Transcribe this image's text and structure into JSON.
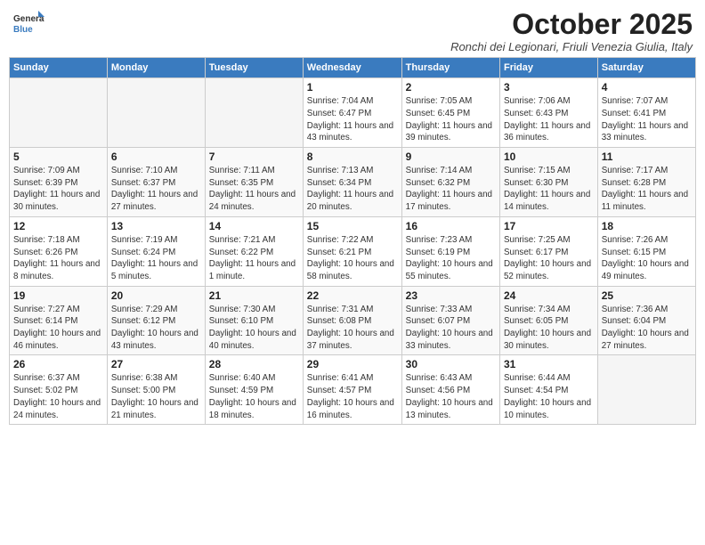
{
  "header": {
    "logo_line1": "General",
    "logo_line2": "Blue",
    "month_year": "October 2025",
    "location": "Ronchi dei Legionari, Friuli Venezia Giulia, Italy"
  },
  "days_of_week": [
    "Sunday",
    "Monday",
    "Tuesday",
    "Wednesday",
    "Thursday",
    "Friday",
    "Saturday"
  ],
  "weeks": [
    [
      {
        "day": "",
        "info": ""
      },
      {
        "day": "",
        "info": ""
      },
      {
        "day": "",
        "info": ""
      },
      {
        "day": "1",
        "info": "Sunrise: 7:04 AM\nSunset: 6:47 PM\nDaylight: 11 hours and 43 minutes."
      },
      {
        "day": "2",
        "info": "Sunrise: 7:05 AM\nSunset: 6:45 PM\nDaylight: 11 hours and 39 minutes."
      },
      {
        "day": "3",
        "info": "Sunrise: 7:06 AM\nSunset: 6:43 PM\nDaylight: 11 hours and 36 minutes."
      },
      {
        "day": "4",
        "info": "Sunrise: 7:07 AM\nSunset: 6:41 PM\nDaylight: 11 hours and 33 minutes."
      }
    ],
    [
      {
        "day": "5",
        "info": "Sunrise: 7:09 AM\nSunset: 6:39 PM\nDaylight: 11 hours and 30 minutes."
      },
      {
        "day": "6",
        "info": "Sunrise: 7:10 AM\nSunset: 6:37 PM\nDaylight: 11 hours and 27 minutes."
      },
      {
        "day": "7",
        "info": "Sunrise: 7:11 AM\nSunset: 6:35 PM\nDaylight: 11 hours and 24 minutes."
      },
      {
        "day": "8",
        "info": "Sunrise: 7:13 AM\nSunset: 6:34 PM\nDaylight: 11 hours and 20 minutes."
      },
      {
        "day": "9",
        "info": "Sunrise: 7:14 AM\nSunset: 6:32 PM\nDaylight: 11 hours and 17 minutes."
      },
      {
        "day": "10",
        "info": "Sunrise: 7:15 AM\nSunset: 6:30 PM\nDaylight: 11 hours and 14 minutes."
      },
      {
        "day": "11",
        "info": "Sunrise: 7:17 AM\nSunset: 6:28 PM\nDaylight: 11 hours and 11 minutes."
      }
    ],
    [
      {
        "day": "12",
        "info": "Sunrise: 7:18 AM\nSunset: 6:26 PM\nDaylight: 11 hours and 8 minutes."
      },
      {
        "day": "13",
        "info": "Sunrise: 7:19 AM\nSunset: 6:24 PM\nDaylight: 11 hours and 5 minutes."
      },
      {
        "day": "14",
        "info": "Sunrise: 7:21 AM\nSunset: 6:22 PM\nDaylight: 11 hours and 1 minute."
      },
      {
        "day": "15",
        "info": "Sunrise: 7:22 AM\nSunset: 6:21 PM\nDaylight: 10 hours and 58 minutes."
      },
      {
        "day": "16",
        "info": "Sunrise: 7:23 AM\nSunset: 6:19 PM\nDaylight: 10 hours and 55 minutes."
      },
      {
        "day": "17",
        "info": "Sunrise: 7:25 AM\nSunset: 6:17 PM\nDaylight: 10 hours and 52 minutes."
      },
      {
        "day": "18",
        "info": "Sunrise: 7:26 AM\nSunset: 6:15 PM\nDaylight: 10 hours and 49 minutes."
      }
    ],
    [
      {
        "day": "19",
        "info": "Sunrise: 7:27 AM\nSunset: 6:14 PM\nDaylight: 10 hours and 46 minutes."
      },
      {
        "day": "20",
        "info": "Sunrise: 7:29 AM\nSunset: 6:12 PM\nDaylight: 10 hours and 43 minutes."
      },
      {
        "day": "21",
        "info": "Sunrise: 7:30 AM\nSunset: 6:10 PM\nDaylight: 10 hours and 40 minutes."
      },
      {
        "day": "22",
        "info": "Sunrise: 7:31 AM\nSunset: 6:08 PM\nDaylight: 10 hours and 37 minutes."
      },
      {
        "day": "23",
        "info": "Sunrise: 7:33 AM\nSunset: 6:07 PM\nDaylight: 10 hours and 33 minutes."
      },
      {
        "day": "24",
        "info": "Sunrise: 7:34 AM\nSunset: 6:05 PM\nDaylight: 10 hours and 30 minutes."
      },
      {
        "day": "25",
        "info": "Sunrise: 7:36 AM\nSunset: 6:04 PM\nDaylight: 10 hours and 27 minutes."
      }
    ],
    [
      {
        "day": "26",
        "info": "Sunrise: 6:37 AM\nSunset: 5:02 PM\nDaylight: 10 hours and 24 minutes."
      },
      {
        "day": "27",
        "info": "Sunrise: 6:38 AM\nSunset: 5:00 PM\nDaylight: 10 hours and 21 minutes."
      },
      {
        "day": "28",
        "info": "Sunrise: 6:40 AM\nSunset: 4:59 PM\nDaylight: 10 hours and 18 minutes."
      },
      {
        "day": "29",
        "info": "Sunrise: 6:41 AM\nSunset: 4:57 PM\nDaylight: 10 hours and 16 minutes."
      },
      {
        "day": "30",
        "info": "Sunrise: 6:43 AM\nSunset: 4:56 PM\nDaylight: 10 hours and 13 minutes."
      },
      {
        "day": "31",
        "info": "Sunrise: 6:44 AM\nSunset: 4:54 PM\nDaylight: 10 hours and 10 minutes."
      },
      {
        "day": "",
        "info": ""
      }
    ]
  ]
}
